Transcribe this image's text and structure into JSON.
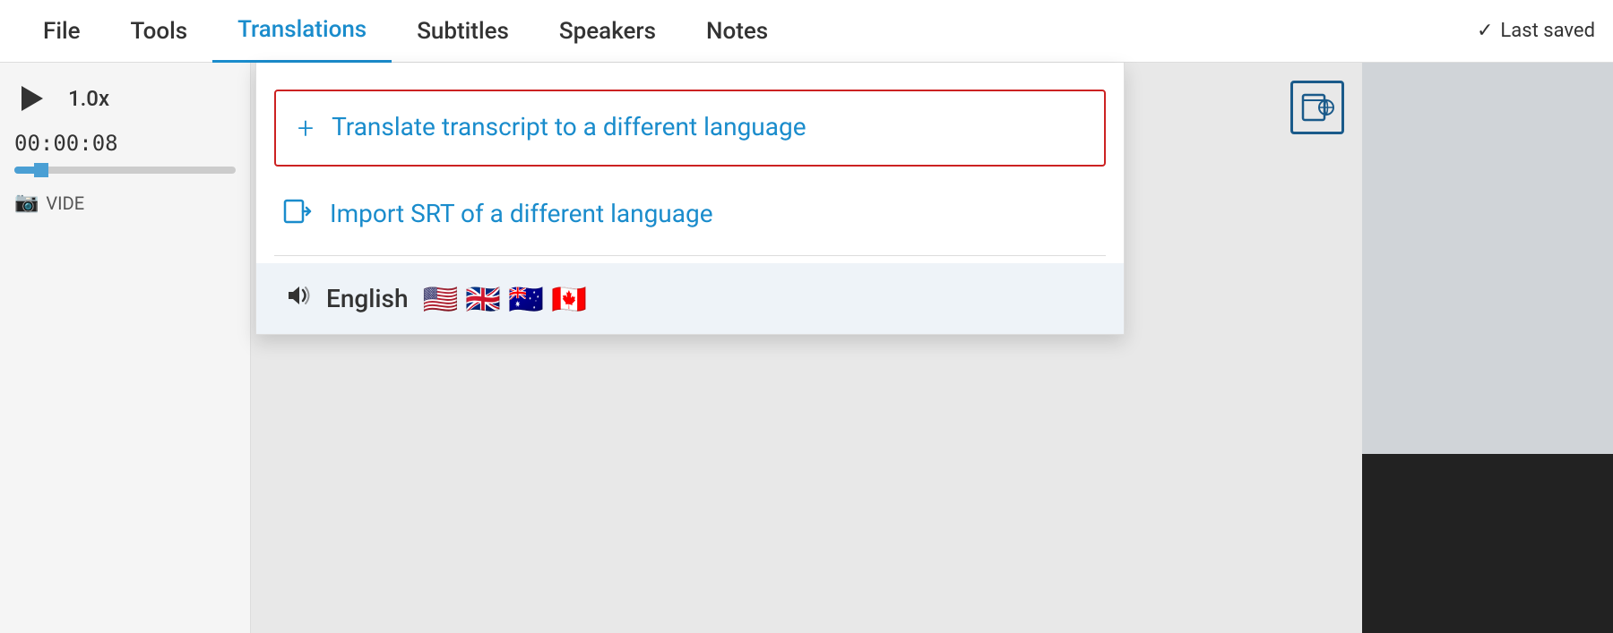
{
  "nav": {
    "file_label": "File",
    "tools_label": "Tools",
    "translations_label": "Translations",
    "subtitles_label": "Subtitles",
    "speakers_label": "Speakers",
    "notes_label": "Notes",
    "last_saved_label": "Last saved"
  },
  "player": {
    "speed": "1.0x",
    "timestamp": "00:00:08",
    "video_label": "VIDE"
  },
  "dropdown": {
    "translate_label": "Translate transcript to a different language",
    "import_label": "Import SRT of a different language",
    "language_label": "English",
    "flags": [
      "🇺🇸",
      "🇬🇧",
      "🇦🇺",
      "🇨🇦"
    ]
  }
}
